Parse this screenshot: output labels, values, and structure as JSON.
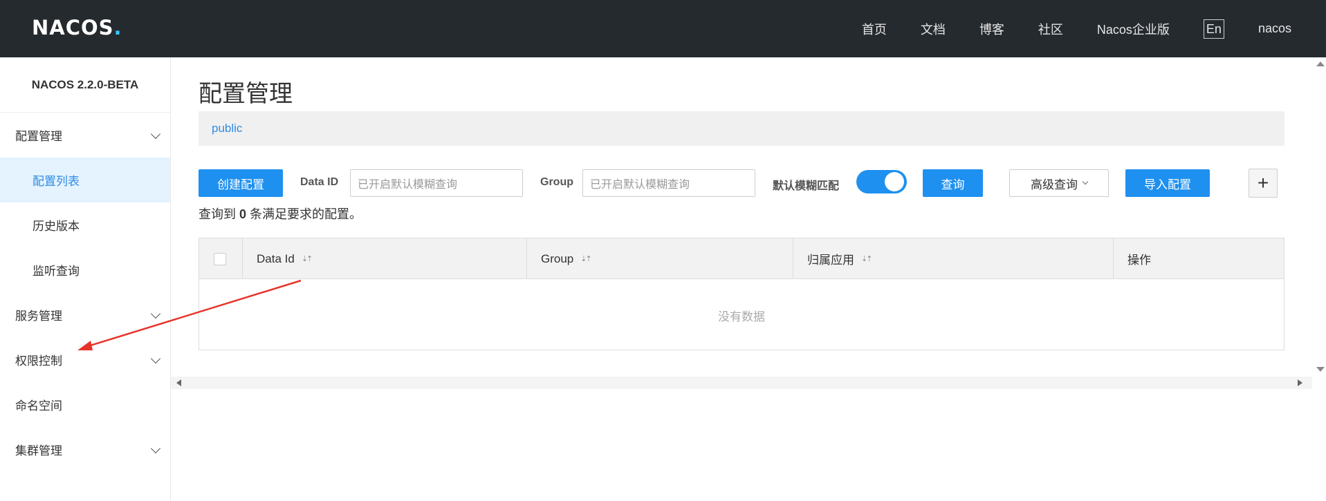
{
  "header": {
    "logo_text_a": "NACOS",
    "logo_text_b": ".",
    "nav": [
      "首页",
      "文档",
      "博客",
      "社区",
      "Nacos企业版"
    ],
    "lang": "En",
    "user": "nacos"
  },
  "sidebar": {
    "title": "NACOS 2.2.0-BETA",
    "items": [
      {
        "label": "配置管理",
        "type": "group"
      },
      {
        "label": "配置列表",
        "type": "sub",
        "active": true
      },
      {
        "label": "历史版本",
        "type": "sub"
      },
      {
        "label": "监听查询",
        "type": "sub"
      },
      {
        "label": "服务管理",
        "type": "group"
      },
      {
        "label": "权限控制",
        "type": "group"
      },
      {
        "label": "命名空间",
        "type": "item"
      },
      {
        "label": "集群管理",
        "type": "group"
      }
    ]
  },
  "main": {
    "title": "配置管理",
    "namespace": "public",
    "toolbar": {
      "create_label": "创建配置",
      "dataid_label": "Data ID",
      "dataid_placeholder": "已开启默认模糊查询",
      "group_label": "Group",
      "group_placeholder": "已开启默认模糊查询",
      "fuzzy_label": "默认模糊匹配",
      "fuzzy_on": true,
      "query_label": "查询",
      "advanced_label": "高级查询",
      "import_label": "导入配置",
      "plus_label": "+"
    },
    "result": {
      "prefix": "查询到",
      "count": "0",
      "suffix": "条满足要求的配置。"
    },
    "table": {
      "columns": [
        "Data Id",
        "Group",
        "归属应用",
        "操作"
      ],
      "empty_text": "没有数据"
    }
  },
  "colors": {
    "header_bg": "#252a2f",
    "primary": "#1e90f0",
    "active_bg": "#e5f3fe",
    "annotation_arrow": "#e8332a"
  }
}
